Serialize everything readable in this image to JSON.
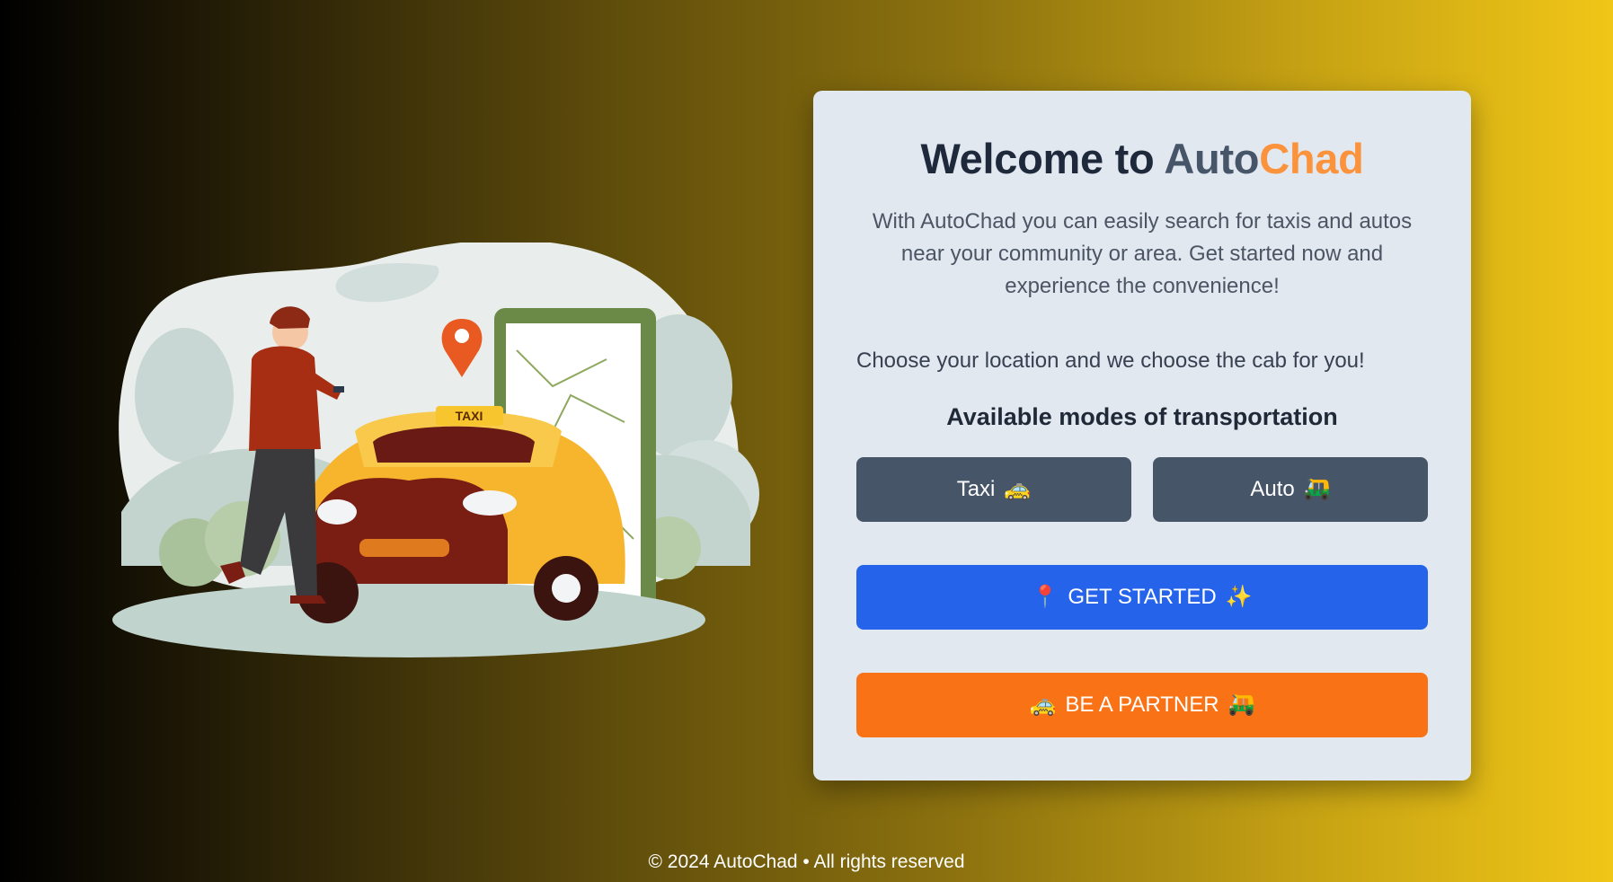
{
  "hero": {
    "title_prefix": "Welcome to ",
    "title_brand_a": "Auto",
    "title_brand_b": "Chad",
    "intro": "With AutoChad you can easily search for taxis and autos near your community or area. Get started now and experience the convenience!",
    "choose_text": "Choose your location and we choose the cab for you!",
    "modes_heading": "Available modes of transportation"
  },
  "illustration": {
    "taxi_sign": "TAXI"
  },
  "modes": [
    {
      "label": "Taxi",
      "icon": "🚕"
    },
    {
      "label": "Auto",
      "icon": "🛺"
    }
  ],
  "actions": {
    "get_started": {
      "left_icon": "📍",
      "label": "GET STARTED",
      "right_icon": "✨"
    },
    "partner": {
      "left_icon": "🚕",
      "label": "BE A PARTNER",
      "right_icon": "🛺"
    }
  },
  "footer": {
    "text": "© 2024 AutoChad • All rights reserved"
  },
  "colors": {
    "primary_blue": "#2563eb",
    "partner_orange": "#f97316",
    "mode_slate": "#475569",
    "brand_orange": "#fb923c",
    "card_bg": "#e2e8f0"
  }
}
